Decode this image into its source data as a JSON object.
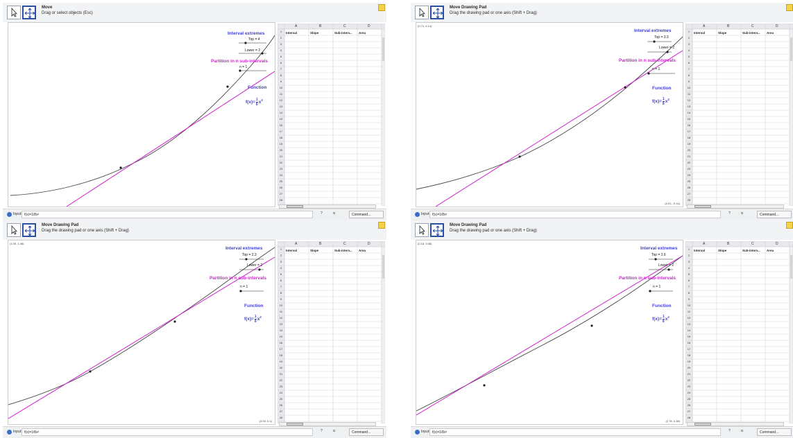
{
  "panels": [
    {
      "mode_title": "Move",
      "mode_help": "Drag or select objects (Esc)",
      "coord_top": "",
      "coord_bottom": "",
      "sliders": {
        "top": "Top = 4",
        "lower": "Lower = 2",
        "n": "n = 1"
      }
    },
    {
      "mode_title": "Move Drawing Pad",
      "mode_help": "Drag the drawing pad or one axis (Shift + Drag)",
      "coord_top": "(0.71, 4.14)",
      "coord_bottom": "(4.01, -0.14)",
      "sliders": {
        "top": "Top = 3.3",
        "lower": "Lower = 2",
        "n": "n = 1"
      }
    },
    {
      "mode_title": "Move Drawing Pad",
      "mode_help": "Drag the drawing pad or one axis (Shift + Drag)",
      "coord_top": "(1.05, 1.46)",
      "coord_bottom": "(3.94, 0.1)",
      "sliders": {
        "top": "Top = 2.3",
        "lower": "Lower = 2",
        "n": "n = 1"
      }
    },
    {
      "mode_title": "Move Drawing Pad",
      "mode_help": "Drag the drawing pad or one axis (Shift + Drag)",
      "coord_top": "(2.18, 0.68)",
      "coord_bottom": "(2.78, 0.38)",
      "sliders": {
        "top": "Top = 2.6",
        "lower": "Lower = 2",
        "n": "n = 1"
      }
    }
  ],
  "labels": {
    "interval_extremes": "Interval extremes",
    "partition": "Partition in n sub-intervals",
    "function": "Function",
    "fx_prefix": "f(x)=",
    "fx_num": "1",
    "fx_den": "8",
    "fx_var": "x",
    "fx_exp": "2"
  },
  "spreadsheet": {
    "cols": [
      "A",
      "B",
      "C",
      "D"
    ],
    "captions": [
      "Interval",
      "Slope",
      "Sub-interv...",
      "Area"
    ],
    "rows": [
      "1",
      "2",
      "3",
      "4",
      "5",
      "6",
      "7",
      "8",
      "9",
      "10",
      "11",
      "12",
      "13",
      "14",
      "15",
      "16",
      "17",
      "18",
      "19",
      "20",
      "21",
      "22",
      "23",
      "24",
      "25",
      "26",
      "27",
      "28"
    ]
  },
  "input_bar": {
    "label": "Input:",
    "value": "f(x)=1/8x²",
    "alpha": "?",
    "beta": "α",
    "command": "Command..."
  },
  "colors": {
    "accent_magenta": "#d11fd1",
    "label_blue": "#3f3fd6",
    "curve": "#444444",
    "tool_border": "#2b4fa3"
  }
}
